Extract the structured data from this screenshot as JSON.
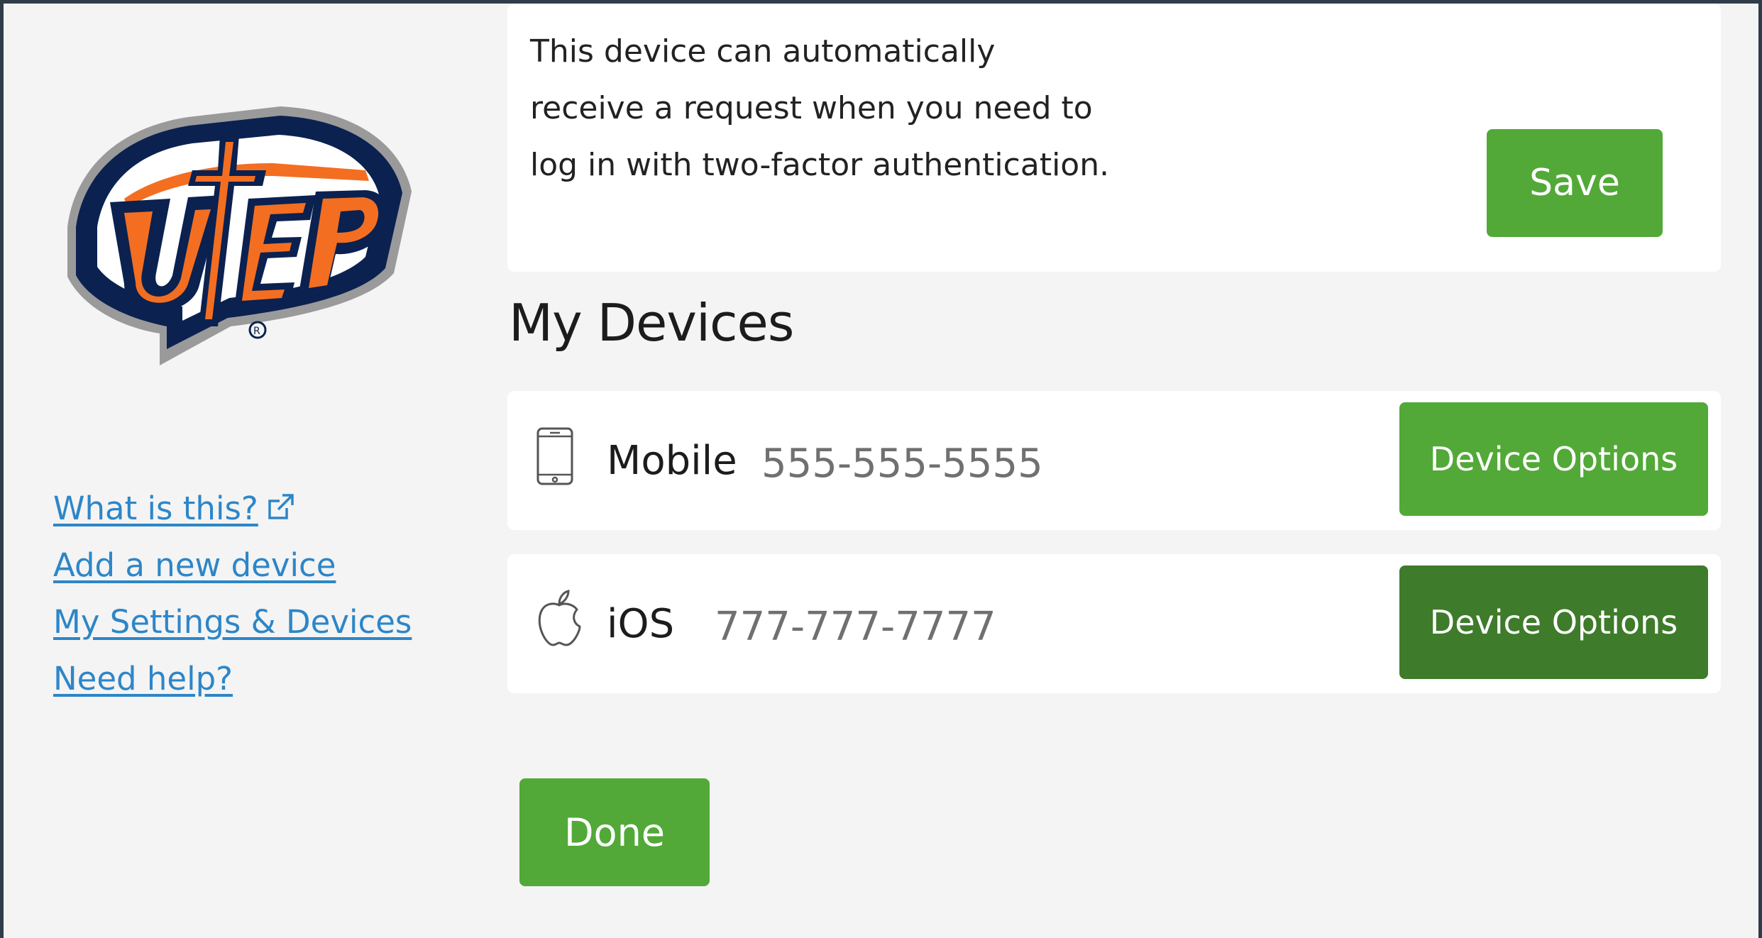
{
  "links": {
    "what_is_this": "What is this?",
    "add_device": "Add a new device",
    "settings_devices": "My Settings & Devices",
    "need_help": "Need help?"
  },
  "auto_request": {
    "text": "This device can automatically receive a request when you need to log in with two-factor authentication.",
    "save_label": "Save"
  },
  "devices_heading": "My Devices",
  "devices": [
    {
      "name": "Mobile",
      "number": "555-555-5555",
      "icon": "smartphone-icon",
      "options_label": "Device Options"
    },
    {
      "name": "iOS",
      "number": "777-777-7777",
      "icon": "apple-icon",
      "options_label": "Device Options"
    }
  ],
  "done_label": "Done",
  "colors": {
    "button_green": "#52a937",
    "button_green_hover": "#3e7b2a",
    "link_blue": "#2d86c8",
    "logo_navy": "#0b2150",
    "logo_orange": "#f36e21"
  }
}
